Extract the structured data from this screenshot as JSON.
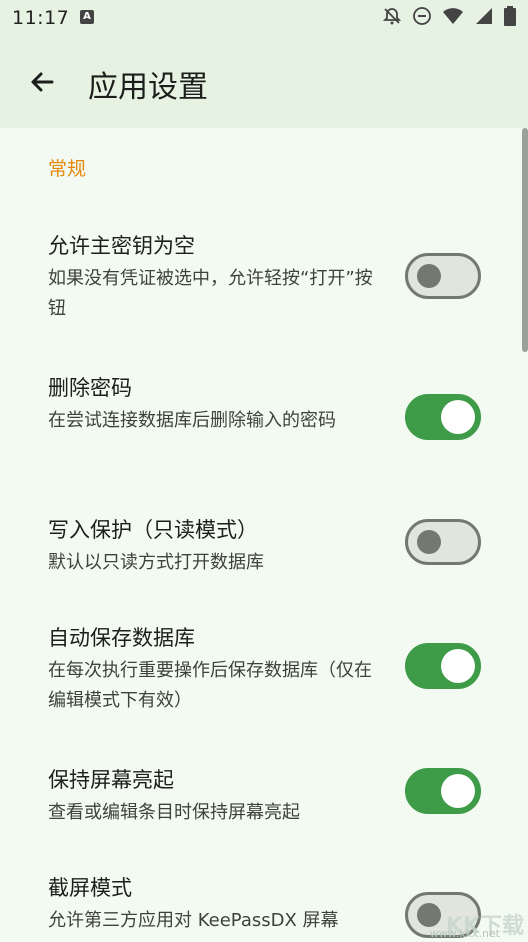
{
  "status_bar": {
    "time": "11:17",
    "notification_label": "A"
  },
  "app_bar": {
    "title": "应用设置"
  },
  "section": {
    "header": "常规"
  },
  "prefs": [
    {
      "title": "允许主密钥为空",
      "summary": "如果没有凭证被选中，允许轻按“打开”按钮",
      "enabled": false
    },
    {
      "title": "删除密码",
      "summary": "在尝试连接数据库后删除输入的密码",
      "enabled": true
    },
    {
      "title": "写入保护（只读模式）",
      "summary": "默认以只读方式打开数据库",
      "enabled": false
    },
    {
      "title": "自动保存数据库",
      "summary": "在每次执行重要操作后保存数据库（仅在编辑模式下有效）",
      "enabled": true
    },
    {
      "title": "保持屏幕亮起",
      "summary": "查看或编辑条目时保持屏幕亮起",
      "enabled": true
    },
    {
      "title": "截屏模式",
      "summary": "允许第三方应用对 KeePassDX 屏幕",
      "enabled": false
    }
  ],
  "colors": {
    "accent": "#e3890f",
    "switch_on": "#3e9b48",
    "switch_off_track": "#e1e5dd",
    "background": "#f3faf1",
    "bar": "#e6f2e2"
  },
  "watermark": {
    "text": "KK下载",
    "sub": "www.kkx.net"
  }
}
